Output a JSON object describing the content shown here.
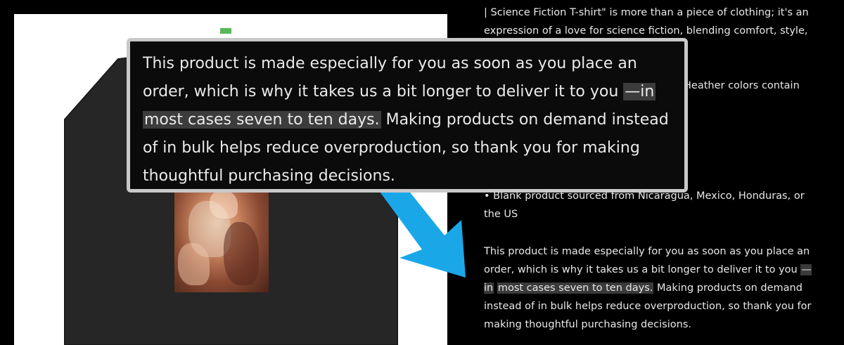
{
  "description": {
    "intro_line_1": "| Science Fiction T-shirt\" is more than a piece of clothing; it's an",
    "intro_line_2": "expression of a love for science fiction, blending comfort, style,",
    "heather_fragment": "Heather colors contain",
    "bullet_line_1": "• Blank product sourced from Nicaragua, Mexico, Honduras, or",
    "bullet_line_2": "the US",
    "made_text_before": "This product is made especially for you as soon as you place an order, which is why it takes us a bit longer to deliver it to you ",
    "made_text_highlight_1": "—in",
    "made_text_highlight_2": "most cases seven to ten days.",
    "made_text_after": " Making products on demand instead of in bulk helps reduce overproduction, so thank you for making thoughtful purchasing decisions."
  },
  "callout": {
    "text_before": "This product is made especially for you as soon as you place an order, which is why it takes us a bit longer to deliver it to you ",
    "highlight_1": "—in",
    "highlight_2": "most cases seven to ten days.",
    "text_after": " Making products on demand instead of in bulk helps reduce overproduction, so thank you for making thoughtful purchasing decisions."
  },
  "colors": {
    "background": "#000000",
    "shirt": "#2a2a2a",
    "highlight": "#3a3a3a",
    "callout_border": "#c9c9c9",
    "arrow": "#1aa7e8"
  },
  "icons": {
    "arrow": "arrow-down-right-icon"
  }
}
